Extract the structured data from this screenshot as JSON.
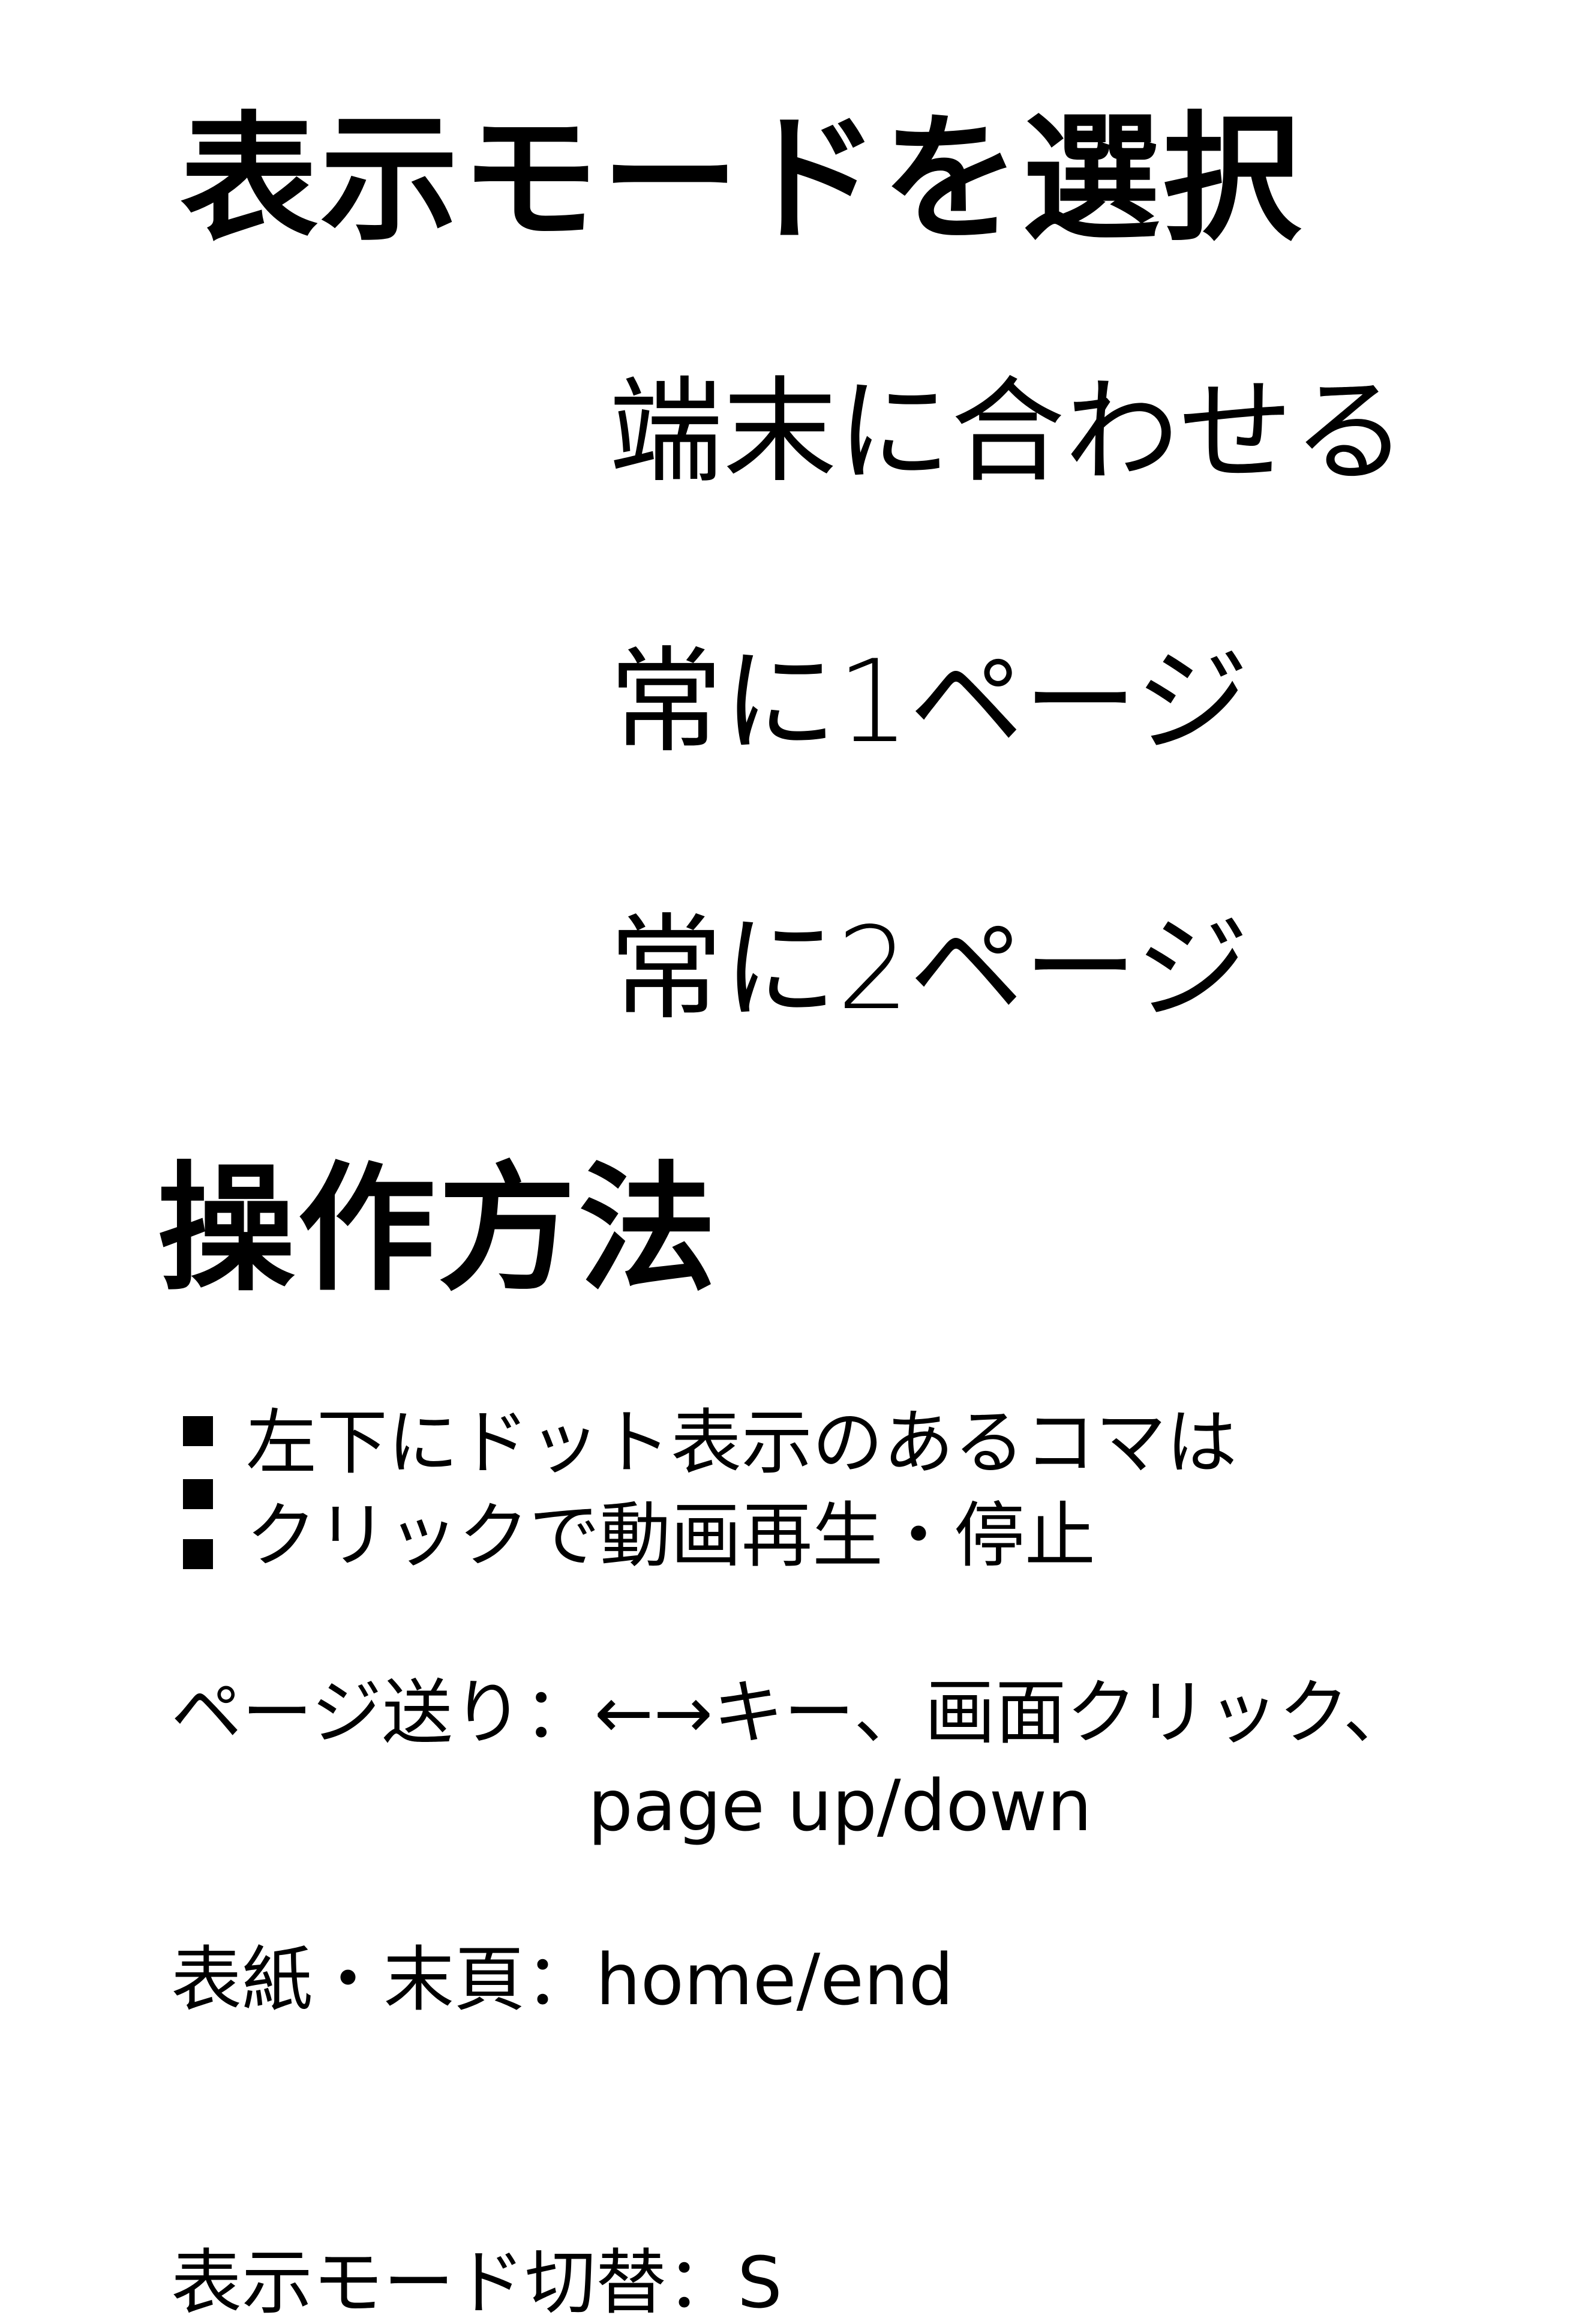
{
  "mode_section": {
    "title": "表示モードを選択",
    "options": [
      {
        "label": "端末に合わせる"
      },
      {
        "label": "常に1ページ"
      },
      {
        "label": "常に2ページ"
      }
    ]
  },
  "ops_section": {
    "title": "操作方法",
    "dot_note_line1": "左下にドット表示のあるコマは",
    "dot_note_line2": "クリックで動画再生・停止",
    "page_turn_line1": "ページ送り：←→キー、画面クリック、",
    "page_turn_line2": "page up/down",
    "cover_end": "表紙・末頁：home/end",
    "mode_toggle": "表示モード切替：S"
  }
}
